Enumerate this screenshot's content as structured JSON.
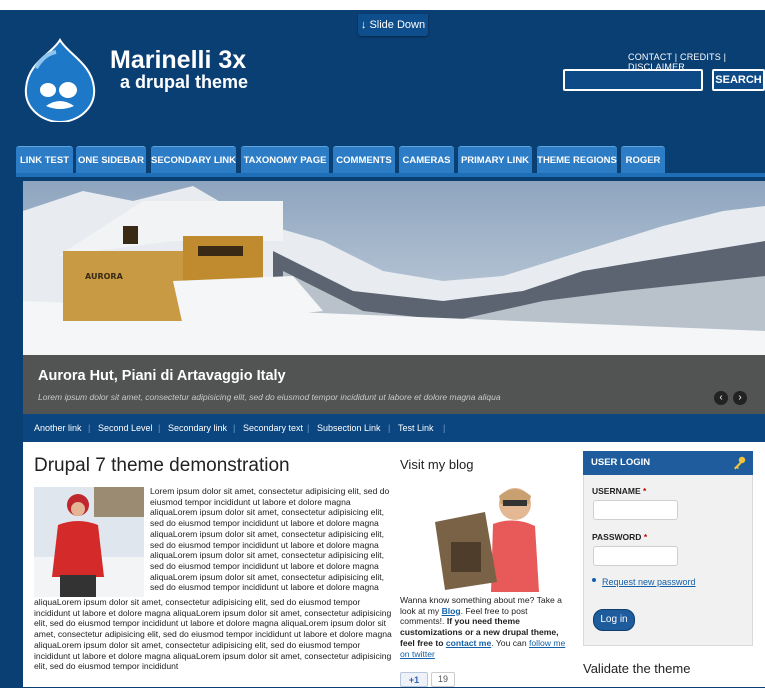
{
  "top": {
    "slide_down": "↓ Slide Down"
  },
  "branding": {
    "site_name": "Marinelli 3x",
    "slogan": "a drupal theme"
  },
  "top_links": [
    "CONTACT",
    "CREDITS",
    "DISCLAIMER"
  ],
  "search": {
    "button": "SEARCH",
    "placeholder": ""
  },
  "main_nav": [
    "LINK TEST",
    "ONE SIDEBAR",
    "SECONDARY LINK",
    "TAXONOMY PAGE",
    "COMMENTS",
    "CAMERAS",
    "PRIMARY LINK",
    "THEME REGIONS",
    "ROGER"
  ],
  "hero": {
    "title": "Aurora Hut, Piani di Artavaggio Italy",
    "text": "Lorem ipsum dolor sit amet, consectetur adipisicing elit, sed do eiusmod tempor incididunt ut labore et dolore magna aliqua",
    "hut_sign": "AURORA"
  },
  "sub_nav": [
    "Another link",
    "Second Level",
    "Secondary link",
    "Secondary text",
    "Subsection Link",
    "Test Link"
  ],
  "main": {
    "title": "Drupal 7 theme demonstration",
    "paragraph_1": "Lorem ipsum dolor sit amet, consectetur adipisicing elit, sed do eiusmod tempor incididunt ut labore et dolore magna aliquaLorem ipsum dolor sit amet, consectetur adipisicing elit, sed do eiusmod tempor incididunt ut labore et dolore magna aliquaLorem ipsum dolor sit amet, consectetur adipisicing elit, sed do eiusmod tempor incididunt ut labore et dolore magna aliquaLorem ipsum dolor sit amet, consectetur adipisicing elit, sed do eiusmod tempor incididunt ut labore et dolore magna aliquaLorem ipsum dolor sit amet, consectetur adipisicing elit, sed do eiusmod tempor incididunt ut labore et dolore magna",
    "paragraph_2": "aliquaLorem ipsum dolor sit amet, consectetur adipisicing elit, sed do eiusmod tempor incididunt ut labore et dolore magna aliquaLorem ipsum dolor sit amet, consectetur adipisicing elit, sed do eiusmod tempor incididunt ut labore et dolore magna aliquaLorem ipsum dolor sit amet, consectetur adipisicing elit, sed do eiusmod tempor incididunt ut labore et dolore magna aliquaLorem ipsum dolor sit amet, consectetur adipisicing elit, sed do eiusmod tempor incididunt ut labore et dolore magna aliquaLorem ipsum dolor sit amet, consectetur adipisicing elit, sed do eiusmod tempor incididunt"
  },
  "blog": {
    "title": "Visit my blog",
    "text_1": "Wanna know something about me? Take a look at my ",
    "blog_link": "Blog",
    "text_2": ". Feel free to post comments!. ",
    "bold_1": "If you need theme customizations or a new drupal theme, feel free to ",
    "contact_link": "contact me",
    "text_3": ". You can ",
    "follow_link": "follow me on twitter",
    "plusone": "+1",
    "plusone_count": "19"
  },
  "login": {
    "header": "USER LOGIN",
    "username_label": "USERNAME",
    "password_label": "PASSWORD",
    "required_mark": "*",
    "request_link": "Request new password",
    "button": "Log in"
  },
  "validate": {
    "title": "Validate the theme"
  },
  "colors": {
    "header_bg": "#0a3f74",
    "nav_tab": "#2d7cc6",
    "link": "#1361a8"
  }
}
